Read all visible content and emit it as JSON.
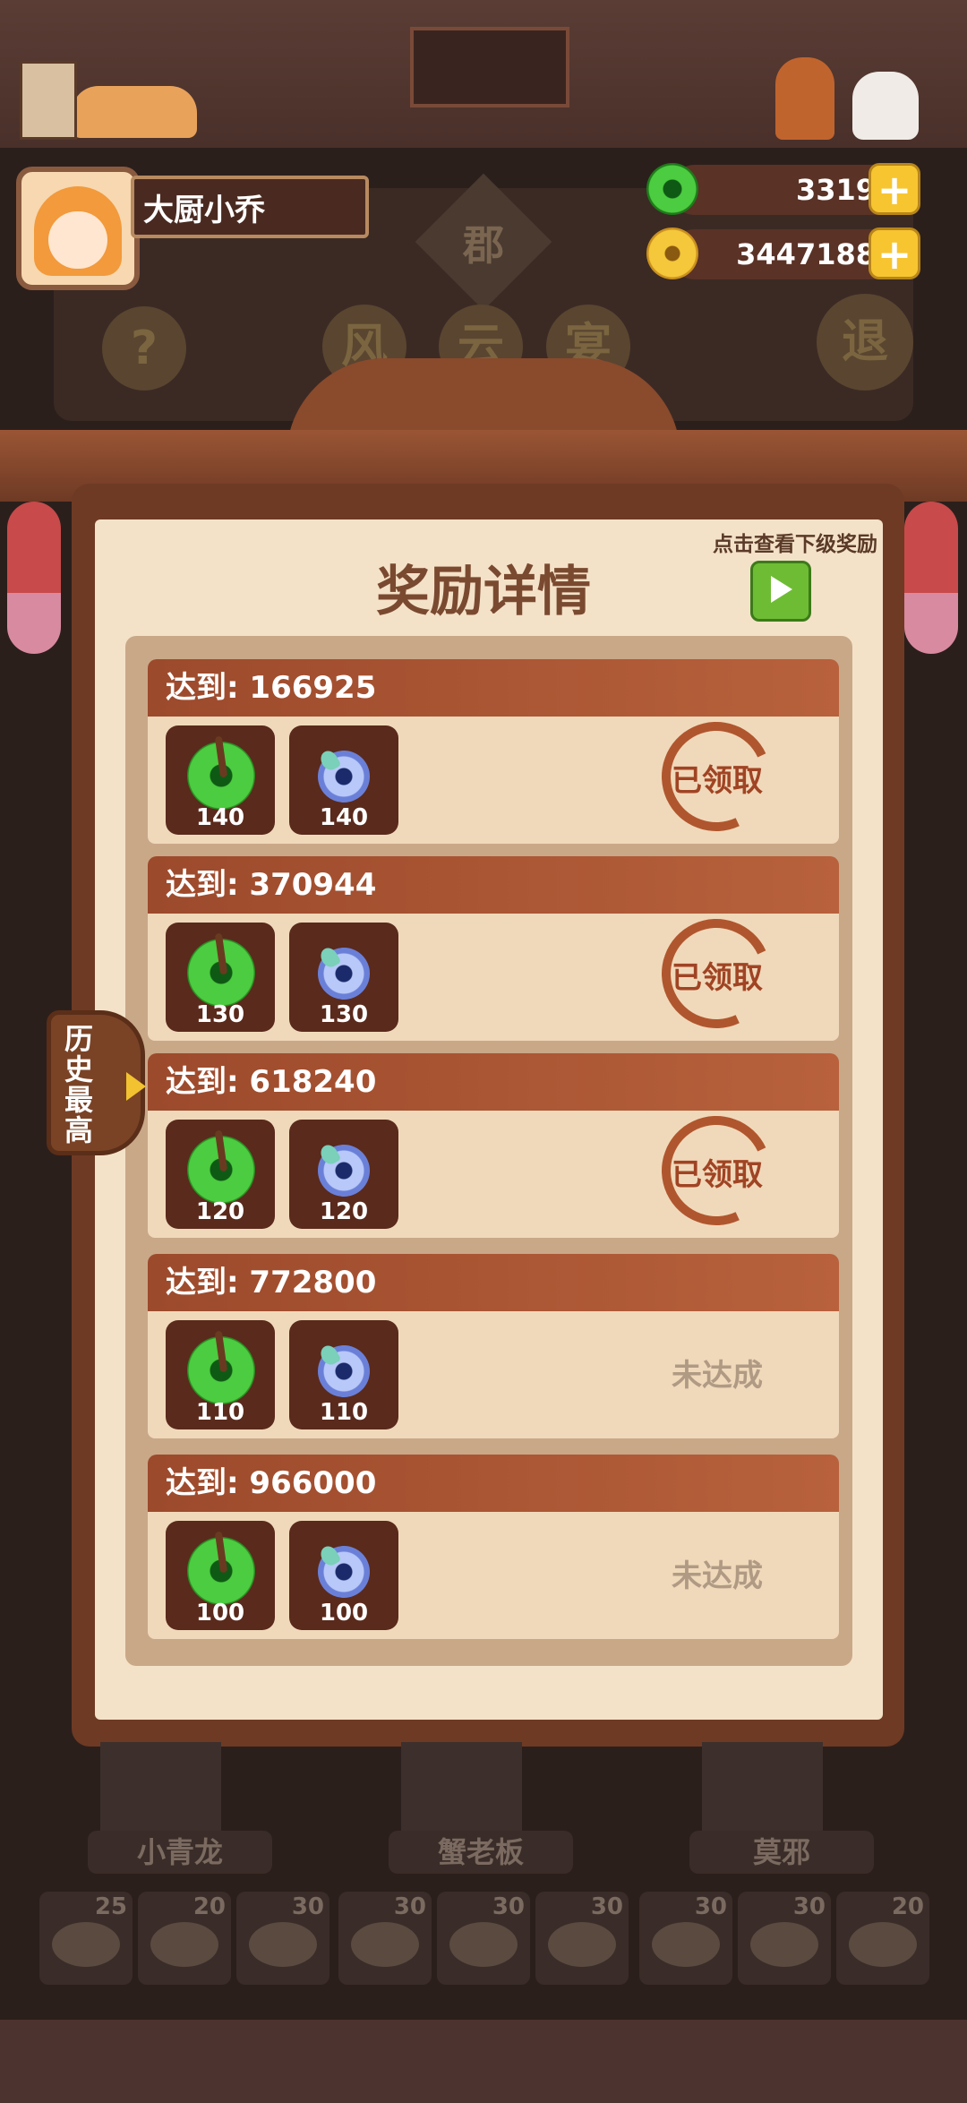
{
  "profile": {
    "name": "大厨小乔"
  },
  "currency": {
    "jade": {
      "icon": "jade-coin-icon",
      "value": "3319"
    },
    "gold": {
      "icon": "gold-coin-icon",
      "value": "3447188"
    }
  },
  "background_buttons": [
    "?",
    "风",
    "云",
    "宴",
    "退"
  ],
  "background_plaque": "郡",
  "panel": {
    "title": "奖励详情",
    "next_hint": "点击查看下级奖励"
  },
  "side_tab": {
    "label": "历史最高"
  },
  "tiers": [
    {
      "label": "达到: 166925",
      "jade": "140",
      "gem": "140",
      "status": "已领取",
      "claimed": true
    },
    {
      "label": "达到: 370944",
      "jade": "130",
      "gem": "130",
      "status": "已领取",
      "claimed": true
    },
    {
      "label": "达到: 618240",
      "jade": "120",
      "gem": "120",
      "status": "已领取",
      "claimed": true
    },
    {
      "label": "达到: 772800",
      "jade": "110",
      "gem": "110",
      "status": "未达成",
      "claimed": false
    },
    {
      "label": "达到: 966000",
      "jade": "100",
      "gem": "100",
      "status": "未达成",
      "claimed": false
    }
  ],
  "characters": [
    "小青龙",
    "蟹老板",
    "莫邪"
  ],
  "dishes": [
    "25",
    "20",
    "30",
    "30",
    "30",
    "30",
    "30",
    "30",
    "20"
  ],
  "colors": {
    "header": "#9c4a2c",
    "panel": "#f4e2c8",
    "claimed_stamp": "#a04424",
    "pending": "#b09a84"
  }
}
